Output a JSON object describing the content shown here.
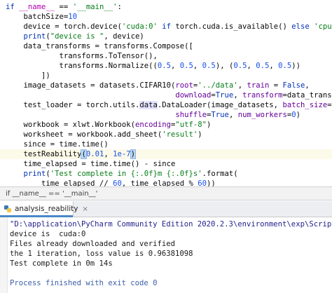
{
  "editor": {
    "lines": [
      {
        "segments": [
          {
            "t": "if ",
            "c": "kw"
          },
          {
            "t": "__name__",
            "c": "dunder"
          },
          {
            "t": " == ",
            "c": ""
          },
          {
            "t": "'__main__'",
            "c": "str"
          },
          {
            "t": ":",
            "c": ""
          }
        ]
      },
      {
        "segments": [
          {
            "t": "    batchSize=",
            "c": ""
          },
          {
            "t": "10",
            "c": "num"
          }
        ]
      },
      {
        "segments": [
          {
            "t": "    device = torch.device(",
            "c": ""
          },
          {
            "t": "'cuda:0'",
            "c": "str"
          },
          {
            "t": " if ",
            "c": "kw"
          },
          {
            "t": "torch.cuda.is_available() ",
            "c": ""
          },
          {
            "t": "else ",
            "c": "kw"
          },
          {
            "t": "'cpu'",
            "c": "str"
          },
          {
            "t": ")",
            "c": ""
          }
        ]
      },
      {
        "segments": [
          {
            "t": "    ",
            "c": ""
          },
          {
            "t": "print",
            "c": "kw"
          },
          {
            "t": "(",
            "c": ""
          },
          {
            "t": "\"device is \"",
            "c": "str"
          },
          {
            "t": ", device)",
            "c": ""
          }
        ]
      },
      {
        "segments": [
          {
            "t": "    data_transforms = transforms.Compose([",
            "c": ""
          }
        ]
      },
      {
        "segments": [
          {
            "t": "            transforms.ToTensor(),",
            "c": ""
          }
        ]
      },
      {
        "segments": [
          {
            "t": "            transforms.Normalize((",
            "c": ""
          },
          {
            "t": "0.5",
            "c": "num"
          },
          {
            "t": ", ",
            "c": ""
          },
          {
            "t": "0.5",
            "c": "num"
          },
          {
            "t": ", ",
            "c": ""
          },
          {
            "t": "0.5",
            "c": "num"
          },
          {
            "t": "), (",
            "c": ""
          },
          {
            "t": "0.5",
            "c": "num"
          },
          {
            "t": ", ",
            "c": ""
          },
          {
            "t": "0.5",
            "c": "num"
          },
          {
            "t": ", ",
            "c": ""
          },
          {
            "t": "0.5",
            "c": "num"
          },
          {
            "t": "))",
            "c": ""
          }
        ]
      },
      {
        "segments": [
          {
            "t": "        ])",
            "c": ""
          }
        ]
      },
      {
        "segments": [
          {
            "t": "    image_datasets = datasets.CIFAR10(",
            "c": ""
          },
          {
            "t": "root",
            "c": "par"
          },
          {
            "t": "=",
            "c": ""
          },
          {
            "t": "'../data'",
            "c": "str"
          },
          {
            "t": ", ",
            "c": ""
          },
          {
            "t": "train",
            "c": "par"
          },
          {
            "t": " = ",
            "c": ""
          },
          {
            "t": "False",
            "c": "kw"
          },
          {
            "t": ",",
            "c": ""
          }
        ]
      },
      {
        "segments": [
          {
            "t": "                                      ",
            "c": ""
          },
          {
            "t": "download",
            "c": "par"
          },
          {
            "t": "=",
            "c": ""
          },
          {
            "t": "True",
            "c": "kw"
          },
          {
            "t": ", ",
            "c": ""
          },
          {
            "t": "transform",
            "c": "par"
          },
          {
            "t": "=data_transforms)",
            "c": ""
          }
        ]
      },
      {
        "segments": [
          {
            "t": "    test_loader = torch.utils.",
            "c": ""
          },
          {
            "t": "data",
            "c": "sel"
          },
          {
            "t": ".DataLoader(image_datasets, ",
            "c": ""
          },
          {
            "t": "batch_size",
            "c": "par"
          },
          {
            "t": "=batchSize,",
            "c": ""
          }
        ]
      },
      {
        "segments": [
          {
            "t": "                                      ",
            "c": ""
          },
          {
            "t": "shuffle",
            "c": "par"
          },
          {
            "t": "=",
            "c": ""
          },
          {
            "t": "True",
            "c": "kw"
          },
          {
            "t": ", ",
            "c": ""
          },
          {
            "t": "num_workers",
            "c": "par"
          },
          {
            "t": "=",
            "c": ""
          },
          {
            "t": "0",
            "c": "num"
          },
          {
            "t": ")",
            "c": ""
          }
        ]
      },
      {
        "segments": [
          {
            "t": "    workbook = xlwt.Workbook(",
            "c": ""
          },
          {
            "t": "encoding",
            "c": "par"
          },
          {
            "t": "=",
            "c": ""
          },
          {
            "t": "\"utf-8\"",
            "c": "str"
          },
          {
            "t": ")",
            "c": ""
          }
        ]
      },
      {
        "segments": [
          {
            "t": "    worksheet = workbook.add_sheet(",
            "c": ""
          },
          {
            "t": "'result'",
            "c": "str"
          },
          {
            "t": ")",
            "c": ""
          }
        ]
      },
      {
        "segments": [
          {
            "t": "    since = time.time()",
            "c": ""
          }
        ]
      },
      {
        "segments": [
          {
            "t": "    testReability",
            "c": ""
          },
          {
            "t": "(",
            "c": "bm"
          },
          {
            "t": "0.01",
            "c": "num"
          },
          {
            "t": ", ",
            "c": ""
          },
          {
            "t": "1e-7",
            "c": "num"
          },
          {
            "t": ")",
            "c": "bm"
          }
        ],
        "highlight": true
      },
      {
        "segments": [
          {
            "t": "    time_elapsed = time.time() - since",
            "c": ""
          }
        ]
      },
      {
        "segments": [
          {
            "t": "    ",
            "c": ""
          },
          {
            "t": "print",
            "c": "kw"
          },
          {
            "t": "(",
            "c": ""
          },
          {
            "t": "'Test complete in {:.0f}m {:.0f}s'",
            "c": "str"
          },
          {
            "t": ".format(",
            "c": ""
          }
        ]
      },
      {
        "segments": [
          {
            "t": "        time_elapsed // ",
            "c": ""
          },
          {
            "t": "60",
            "c": "num"
          },
          {
            "t": ", time_elapsed % ",
            "c": ""
          },
          {
            "t": "60",
            "c": "num"
          },
          {
            "t": "))",
            "c": ""
          }
        ]
      }
    ]
  },
  "breadcrumb": {
    "text": "if __name__ == '__main__'"
  },
  "run_tab": {
    "label": "analysis_reability",
    "close": "×"
  },
  "console": {
    "lines": [
      {
        "text": "\"D:\\application\\PyCharm Community Edition 2020.2.3\\environment\\exp\\Scripts\\python.exe\" D:/",
        "kind": "path"
      },
      {
        "text": "device is  cuda:0",
        "kind": ""
      },
      {
        "text": "Files already downloaded and verified",
        "kind": ""
      },
      {
        "text": "the 1 iteration, loss value is 0.96381098",
        "kind": ""
      },
      {
        "text": "Test complete in 0m 14s",
        "kind": ""
      },
      {
        "text": "",
        "kind": ""
      },
      {
        "text": "Process finished with exit code 0",
        "kind": "exit"
      }
    ]
  }
}
